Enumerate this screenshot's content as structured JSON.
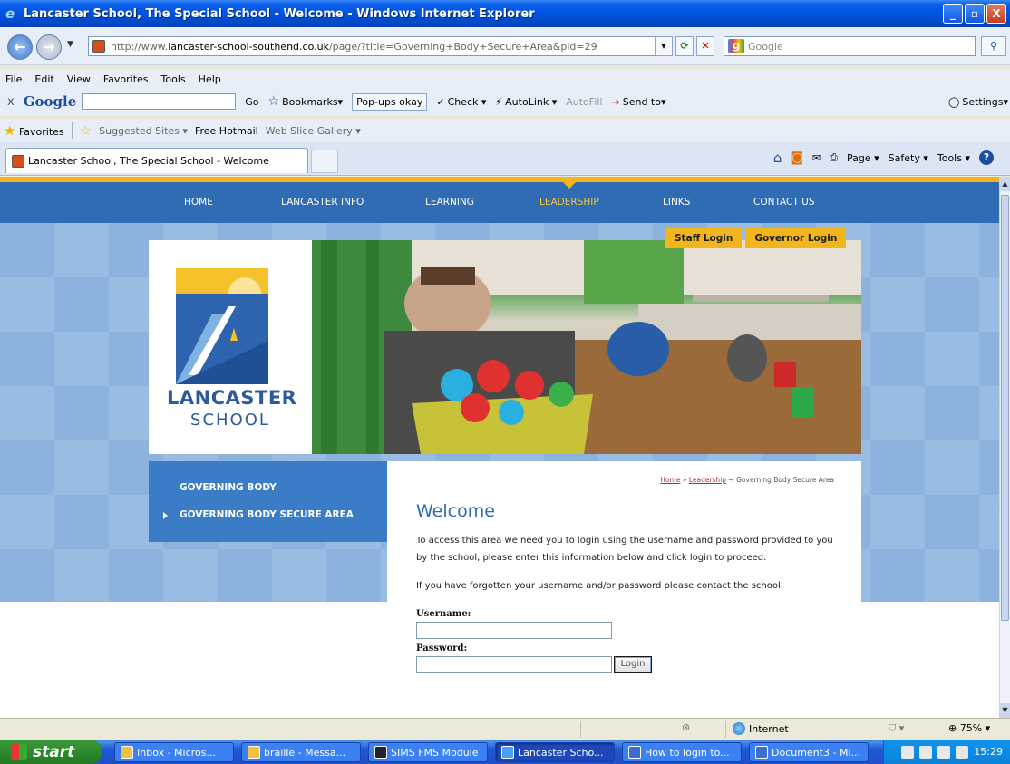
{
  "window": {
    "title": "Lancaster School, The Special School - Welcome - Windows Internet Explorer",
    "buttons": [
      "_",
      "▫",
      "X"
    ]
  },
  "addressbar": {
    "url_prefix": "http://www.",
    "url_domain": "lancaster-school-southend.co.uk",
    "url_path": "/page/?title=Governing+Body+Secure+Area&pid=29",
    "search_placeholder": "Google"
  },
  "menubar": {
    "items": [
      "File",
      "Edit",
      "View",
      "Favorites",
      "Tools",
      "Help"
    ]
  },
  "google_toolbar": {
    "close": "x",
    "brand": "Google",
    "go": "Go",
    "bookmarks": "Bookmarks▾",
    "popups": "Pop-ups okay",
    "check": "Check ▾",
    "autolink": "AutoLink ▾",
    "autofill": "AutoFill",
    "sendto": "Send to▾",
    "settings": "Settings▾"
  },
  "favorites_bar": {
    "favorites": "Favorites",
    "suggested": "Suggested Sites ▾",
    "hotmail": "Free Hotmail",
    "webslice": "Web Slice Gallery ▾"
  },
  "tab": {
    "label": "Lancaster School, The Special School - Welcome"
  },
  "command_bar": {
    "page": "Page ▾",
    "safety": "Safety ▾",
    "tools": "Tools ▾",
    "help": "?"
  },
  "site": {
    "nav": [
      "HOME",
      "LANCASTER INFO",
      "LEARNING",
      "LEADERSHIP",
      "LINKS",
      "CONTACT US"
    ],
    "active_nav": "LEADERSHIP",
    "staff_login": "Staff Login",
    "governor_login": "Governor Login",
    "logo_line1": "LANCASTER",
    "logo_line2": "SCHOOL",
    "sidemenu": [
      "GOVERNING BODY",
      "GOVERNING BODY SECURE AREA"
    ],
    "breadcrumb": {
      "home": "Home",
      "sep1": " » ",
      "leadership": "Leadership",
      "sep2": " → ",
      "current": "Governing Body Secure Area"
    },
    "heading": "Welcome",
    "para1": "To access this area we need you to login using the username and password provided to you by the school, please enter this information below and click login to proceed.",
    "para2": "If you have forgotten your username and/or password please contact the school.",
    "username_label": "Username:",
    "password_label": "Password:",
    "login_button": "Login"
  },
  "statusbar": {
    "zone": "Internet",
    "zoom": "75%"
  },
  "taskbar": {
    "start": "start",
    "tasks": [
      "Inbox - Micros...",
      "braille - Messa...",
      "SIMS FMS Module",
      "Lancaster Scho...",
      "How to login to...",
      "Document3 - Mi..."
    ],
    "clock": "15:29"
  }
}
